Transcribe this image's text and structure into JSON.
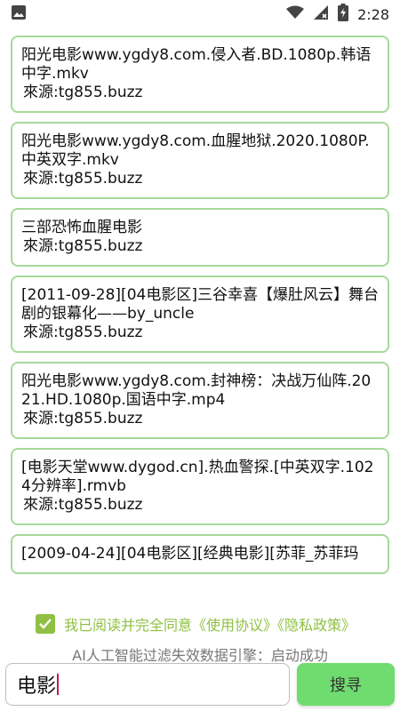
{
  "status_bar": {
    "time": "2:28",
    "icons": [
      "image-icon",
      "wifi-icon",
      "signal-icon",
      "battery-charging-icon"
    ]
  },
  "results": [
    {
      "title": "阳光电影www.ygdy8.com.侵入者.BD.1080p.韩语中字.mkv",
      "source": "來源:tg855.buzz"
    },
    {
      "title": "阳光电影www.ygdy8.com.血腥地狱.2020.1080P.中英双字.mkv",
      "source": "來源:tg855.buzz"
    },
    {
      "title": "三部恐怖血腥电影",
      "source": "來源:tg855.buzz"
    },
    {
      "title": "[2011-09-28][04电影区]三谷幸喜【爆肚风云】舞台剧的银幕化——by_uncle",
      "source": "來源:tg855.buzz"
    },
    {
      "title": "阳光电影www.ygdy8.com.封神榜：决战万仙阵.2021.HD.1080p.国语中字.mp4",
      "source": "來源:tg855.buzz"
    },
    {
      "title": "[电影天堂www.dygod.cn].热血警探.[中英双字.1024分辨率].rmvb",
      "source": "來源:tg855.buzz"
    },
    {
      "title": "[2009-04-24][04电影区][经典电影][苏菲_苏菲玛",
      "source": ""
    }
  ],
  "agreement": {
    "checked": true,
    "text": "我已阅读并完全同意《使用协议》《隐私政策》"
  },
  "engine_status": "AI人工智能过滤失效数据引擎：启动成功",
  "search": {
    "value": "电影",
    "button_label": "搜寻"
  },
  "colors": {
    "accent_green": "#8fc043",
    "card_border": "#a6d99a",
    "button_green": "#6fdc6f"
  }
}
